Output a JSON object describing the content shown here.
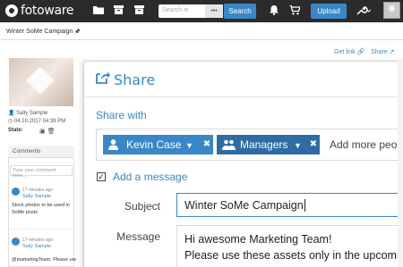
{
  "topbar": {
    "logo_text": "fotoware",
    "search_placeholder": "Search in",
    "search_dots": "•••",
    "search_label": "Search",
    "upload_label": "Upload",
    "icons": [
      "folder-icon",
      "archive-icon",
      "bell-icon",
      "cart-icon",
      "wrench-icon",
      "avatar"
    ]
  },
  "panel": {
    "tab_title": "Winter SoMe Campaign",
    "get_link": "Get link",
    "share": "Share",
    "author": "Sally Sample",
    "date": "04.10.2017 04:39 PM",
    "state_label": "State:",
    "comments_title": "Comments",
    "comment_placeholder": "Type your comment here...",
    "comments": [
      {
        "time": "17 minutes ago",
        "author": "Sally Sample",
        "text": "Stock photos to be used in SoMe posts"
      },
      {
        "time": "17 minutes ago",
        "author": "Sally Sample",
        "text": "@marketingTeam. Please use"
      }
    ]
  },
  "dialog": {
    "title": "Share",
    "share_with": "Share with",
    "recipients": [
      {
        "name": "Kevin Case",
        "type": "user"
      },
      {
        "name": "Managers",
        "type": "group"
      }
    ],
    "add_more": "Add more people",
    "add_message_label": "Add a message",
    "add_message_checked": true,
    "subject_label": "Subject",
    "subject_value": "Winter SoMe Campaign",
    "message_label": "Message",
    "message_line1": "Hi awesome Marketing Team!",
    "message_line2": "Please use these assets only in the upcoming"
  },
  "colors": {
    "accent": "#3a87c8",
    "topbar": "#2b2b2b",
    "chip_dark": "#2d6da3"
  }
}
